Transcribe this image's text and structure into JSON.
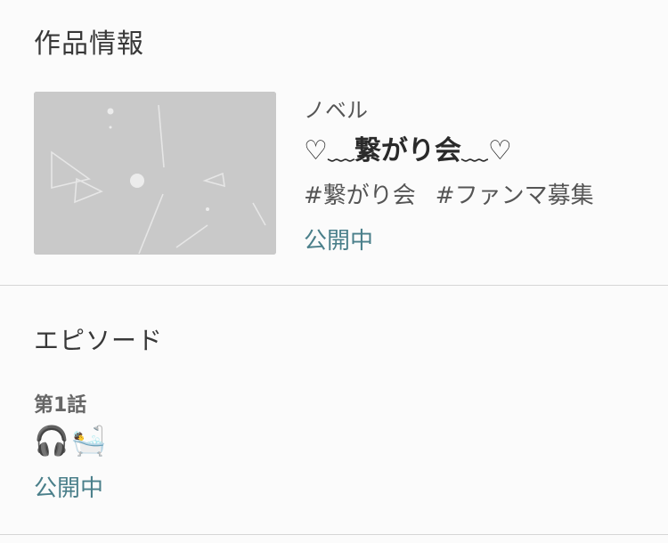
{
  "work_section": {
    "heading": "作品情報",
    "genre": "ノベル",
    "title_prefix": "♡﹏",
    "title_main": "繋がり会",
    "title_suffix": "﹏♡",
    "tags": [
      "#繋がり会",
      "#ファンマ募集"
    ],
    "status": "公開中"
  },
  "episode_section": {
    "heading": "エピソード",
    "episodes": [
      {
        "number": "第1話",
        "title": "🎧🛀",
        "status": "公開中"
      }
    ]
  },
  "colors": {
    "background": "#fbfbfb",
    "thumbnail": "#c9c9c9",
    "status_accent": "#4a7f8a",
    "divider": "#d6d6d6"
  }
}
